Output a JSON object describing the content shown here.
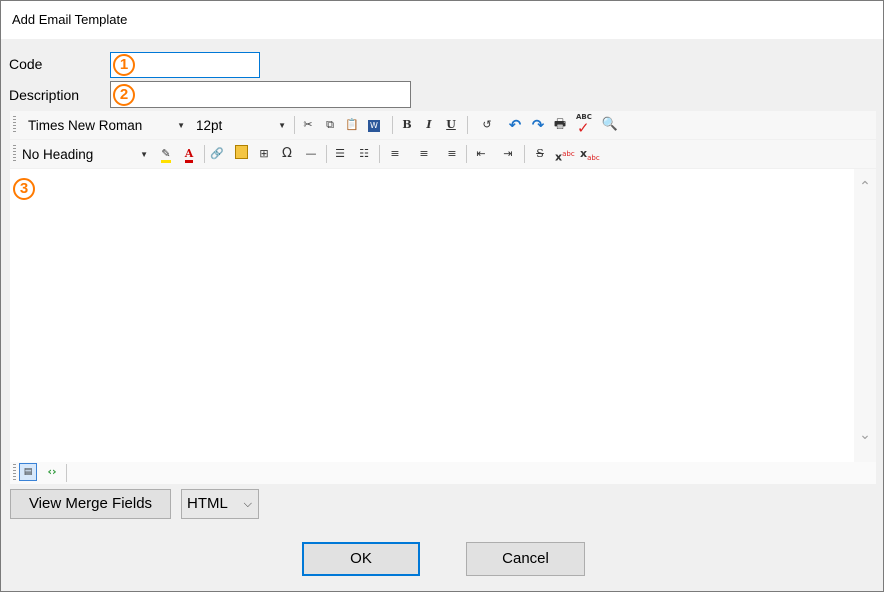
{
  "window": {
    "title": "Add Email Template"
  },
  "form": {
    "code_label": "Code",
    "description_label": "Description",
    "code_value": "",
    "description_value": ""
  },
  "markers": [
    "1",
    "2",
    "3"
  ],
  "toolbar1": {
    "font_family": "Times New Roman",
    "font_size": "12pt",
    "bold": "B",
    "italic": "I",
    "underline": "U"
  },
  "toolbar2": {
    "heading": "No Heading"
  },
  "buttons": {
    "view_merge_fields": "View Merge Fields",
    "ok": "OK",
    "cancel": "Cancel"
  },
  "format_select": {
    "value": "HTML"
  },
  "colors": {
    "marker": "#ff7a00",
    "focus": "#0078d7",
    "undo": "#1e73c8",
    "check": "#d22"
  }
}
